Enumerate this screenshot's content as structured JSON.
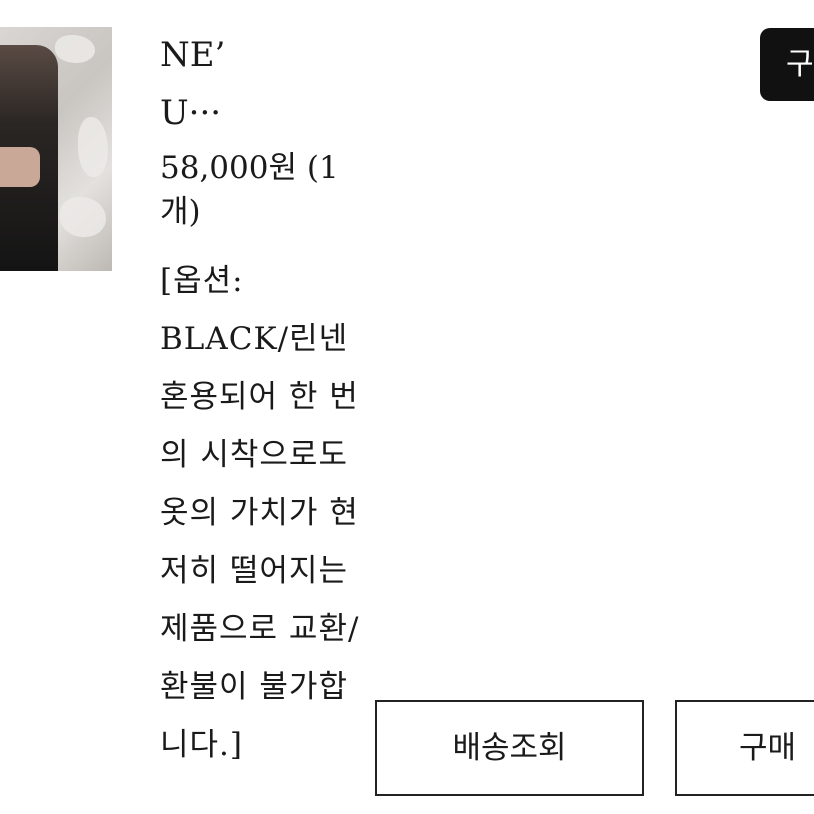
{
  "product": {
    "title_line1": "NE’",
    "title_line2": "U···",
    "price": "58,000원 (1개)",
    "option": "[옵션: BLACK/린넨 혼용되어 한 번의 시착으로도 옷의 가치가 현저히 떨어지는 제품으로 교환/환불이 불가합니다.]"
  },
  "buttons": {
    "top_label": "구",
    "track_label": "배송조회",
    "buy_label": "구매"
  }
}
